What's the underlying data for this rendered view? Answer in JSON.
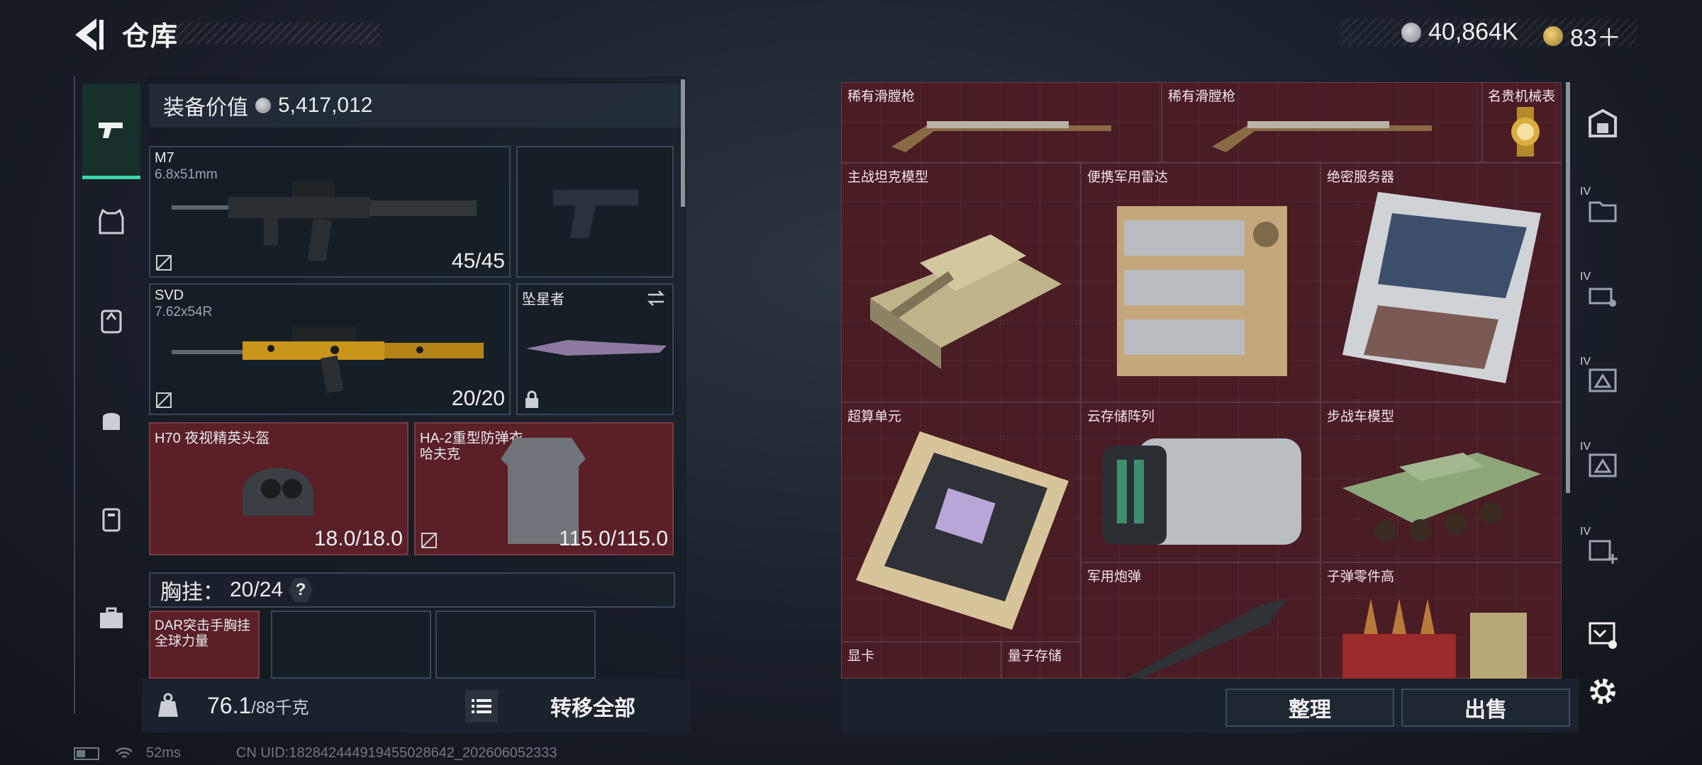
{
  "header": {
    "title": "仓库",
    "currency_1": "40,864K",
    "currency_2": "83＋"
  },
  "gear": {
    "value_label": "装备价值",
    "value": "5,417,012",
    "slots": [
      {
        "name": "M7",
        "sub": "6.8x51mm",
        "count": "45/45"
      },
      {
        "name": "",
        "sub": "",
        "count": ""
      },
      {
        "name": "SVD",
        "sub": "7.62x54R",
        "count": "20/20"
      },
      {
        "name": "坠星者",
        "sub": "",
        "count": ""
      },
      {
        "name": "H70 夜视精英头盔",
        "sub": "",
        "count": "18.0/18.0"
      },
      {
        "name": "HA-2重型防弹衣",
        "sub": "哈夫克",
        "count": "115.0/115.0"
      }
    ],
    "chest_label": "胸挂：",
    "chest_value": "20/24",
    "chest_help": "?",
    "chest_item_line1": "DAR突击手胸挂",
    "chest_item_line2": "全球力量"
  },
  "bottom": {
    "weight": "76.1",
    "weight_max": "/88千克",
    "transfer_all": "转移全部",
    "sort": "整理",
    "sell": "出售"
  },
  "stash": [
    {
      "label": "稀有滑膛枪",
      "icon": "musket-icon"
    },
    {
      "label": "稀有滑膛枪",
      "icon": "musket-icon"
    },
    {
      "label": "名贵机械表",
      "icon": "watch-icon"
    },
    {
      "label": "主战坦克模型",
      "icon": "tank-icon"
    },
    {
      "label": "便携军用雷达",
      "icon": "radar-icon"
    },
    {
      "label": "绝密服务器",
      "icon": "server-icon"
    },
    {
      "label": "超算单元",
      "icon": "computer-board-icon"
    },
    {
      "label": "云存储阵列",
      "icon": "storage-array-icon"
    },
    {
      "label": "步战车模型",
      "icon": "ifv-icon"
    },
    {
      "label": "军用炮弹",
      "icon": "shell-icon"
    },
    {
      "label": "子弹零件高",
      "icon": "bullet-parts-icon"
    },
    {
      "label": "显卡",
      "icon": "gpu-icon"
    },
    {
      "label": "量子存储",
      "icon": "quantum-storage-icon"
    }
  ],
  "rightnav": {
    "iv_1": "IV",
    "iv_2": "IV",
    "iv_3": "IV",
    "iv_4": "IV",
    "iv_5": "IV"
  },
  "status": {
    "ping": "52ms",
    "uid": "CN UID:18284244491945502864​2_202606052333"
  },
  "colors": {
    "accent": "#3ed6a6",
    "item_bg": "#4a1c24",
    "slot_red": "#5a1f27"
  }
}
